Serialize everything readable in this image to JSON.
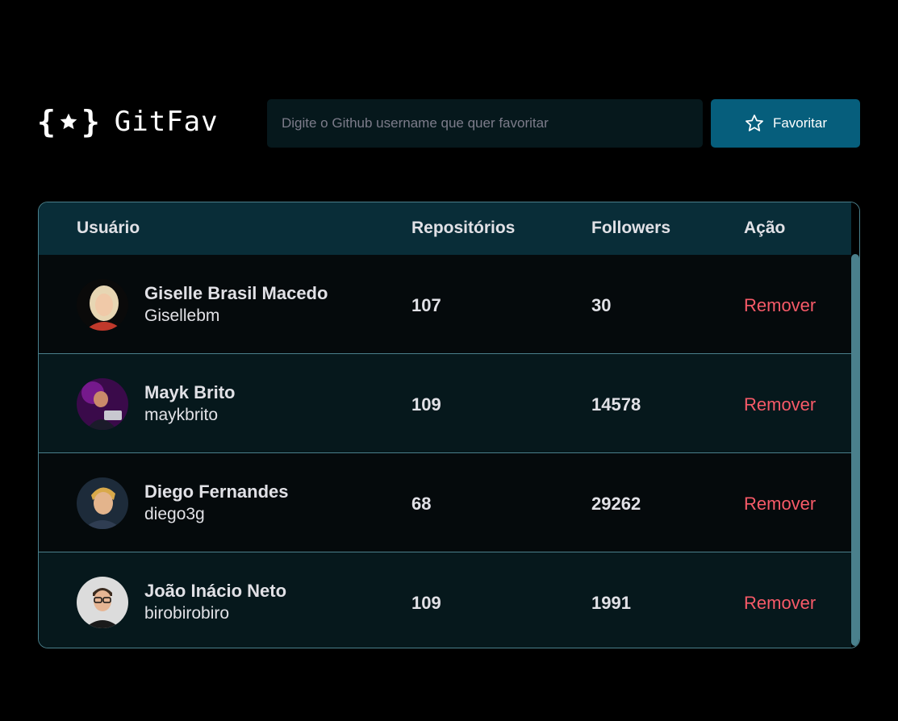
{
  "header": {
    "logo_text": "GitFav",
    "search": {
      "placeholder": "Digite o Github username que quer favoritar",
      "value": ""
    },
    "favorite_button_label": "Favoritar"
  },
  "table": {
    "columns": [
      "Usuário",
      "Repositórios",
      "Followers",
      "Ação"
    ],
    "rows": [
      {
        "name": "Giselle Brasil Macedo",
        "login": "Gisellebm",
        "repositories": "107",
        "followers": "30",
        "action": "Remover"
      },
      {
        "name": "Mayk Brito",
        "login": "maykbrito",
        "repositories": "109",
        "followers": "14578",
        "action": "Remover"
      },
      {
        "name": "Diego Fernandes",
        "login": "diego3g",
        "repositories": "68",
        "followers": "29262",
        "action": "Remover"
      },
      {
        "name": "João Inácio Neto",
        "login": "birobirobiro",
        "repositories": "109",
        "followers": "1991",
        "action": "Remover"
      }
    ]
  },
  "colors": {
    "background": "#000000",
    "header_row": "#092D38",
    "button": "#065E7C",
    "remove": "#F75A68",
    "border": "#4A808C"
  },
  "icons": {
    "logo": "star-braces-icon",
    "favorite": "star-outline-icon"
  }
}
